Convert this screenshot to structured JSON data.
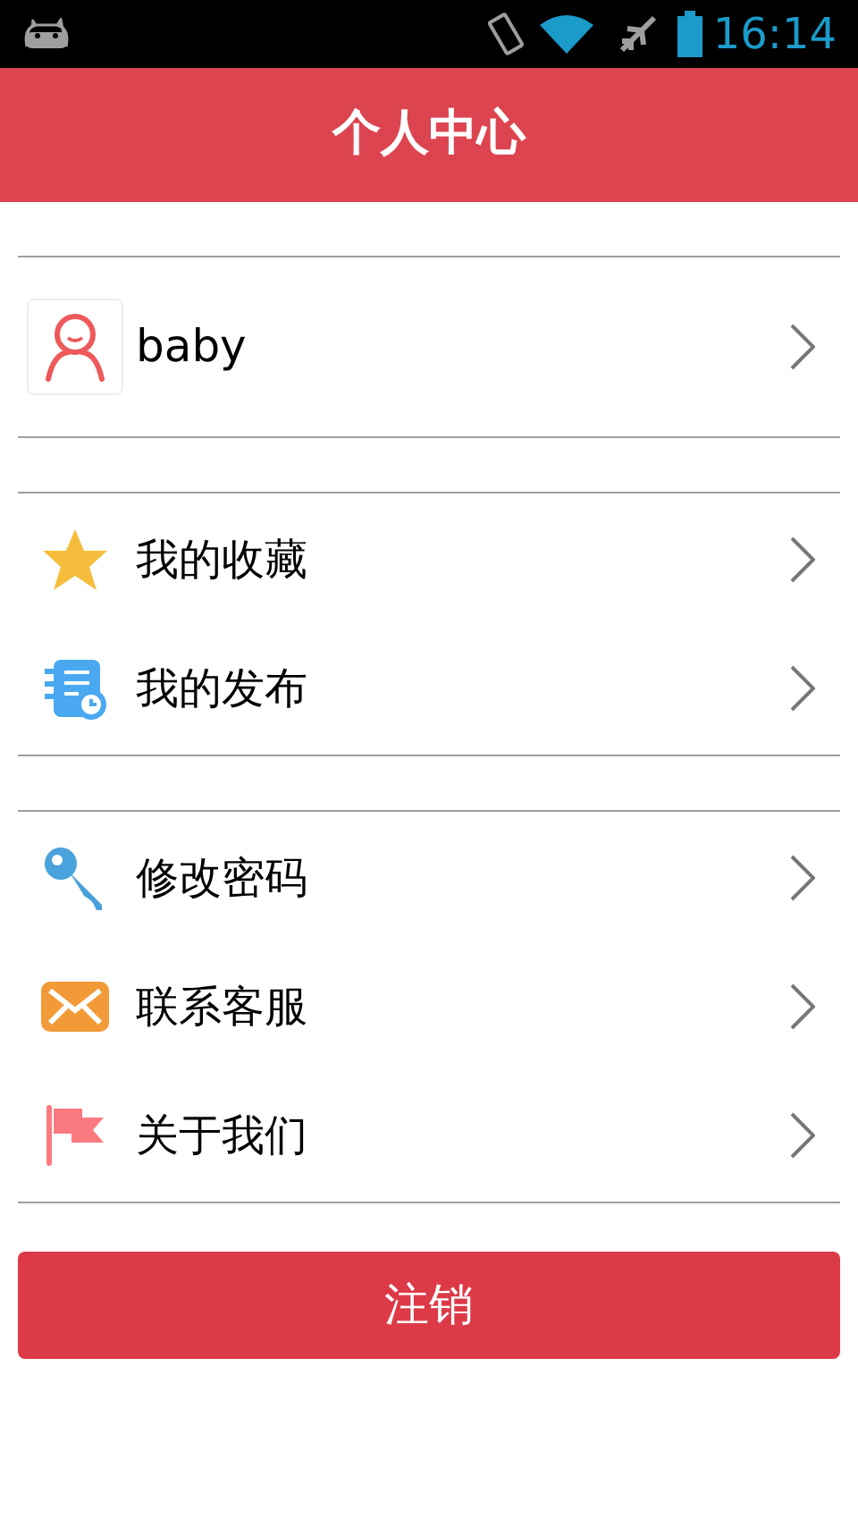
{
  "status_bar": {
    "time": "16:14"
  },
  "header": {
    "title": "个人中心"
  },
  "profile": {
    "name": "baby"
  },
  "groups": [
    {
      "items": [
        {
          "kind": "star",
          "label": "我的收藏"
        },
        {
          "kind": "notes",
          "label": "我的发布"
        }
      ]
    },
    {
      "items": [
        {
          "kind": "key",
          "label": "修改密码"
        },
        {
          "kind": "mail",
          "label": "联系客服"
        },
        {
          "kind": "flag",
          "label": "关于我们"
        }
      ]
    }
  ],
  "logout_button": {
    "label": "注销"
  }
}
